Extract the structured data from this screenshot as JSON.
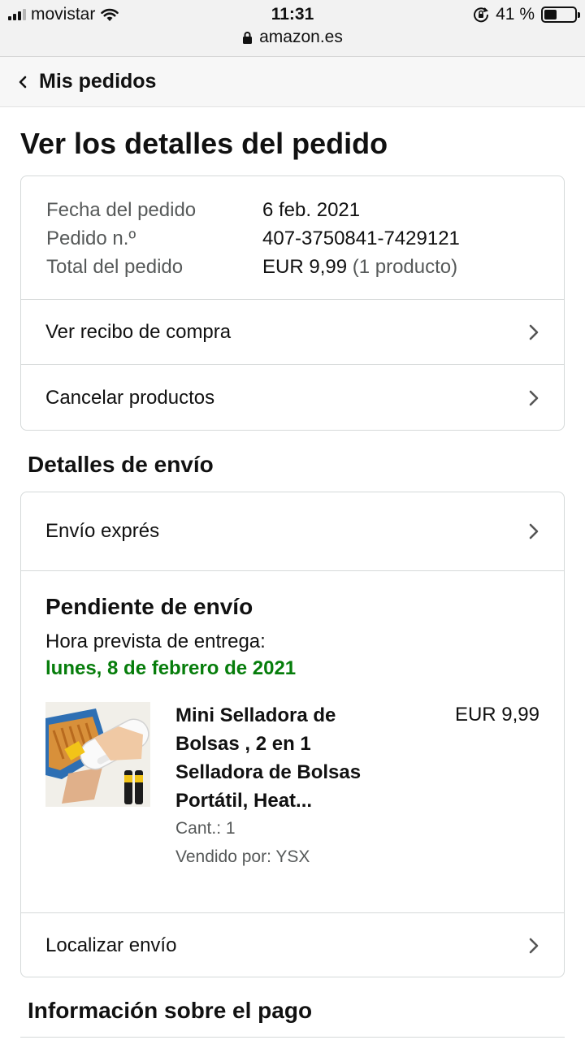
{
  "status_bar": {
    "carrier": "movistar",
    "time": "11:31",
    "battery_percent": "41 %",
    "battery_level": 0.41
  },
  "browser": {
    "url": "amazon.es"
  },
  "nav": {
    "back_label": "Mis pedidos"
  },
  "page": {
    "title": "Ver los detalles del pedido"
  },
  "order": {
    "date_label": "Fecha del pedido",
    "date_value": "6 feb. 2021",
    "number_label": "Pedido n.º",
    "number_value": "407-3750841-7429121",
    "total_label": "Total del pedido",
    "total_value": "EUR 9,99",
    "total_count": "(1 producto)"
  },
  "actions": {
    "receipt": "Ver recibo de compra",
    "cancel": "Cancelar productos"
  },
  "shipping": {
    "section_title": "Detalles de envío",
    "method": "Envío exprés",
    "status": "Pendiente de envío",
    "eta_label": "Hora prevista de entrega:",
    "eta_date": "lunes, 8 de febrero de 2021",
    "track_label": "Localizar envío"
  },
  "product": {
    "name": "Mini Selladora de Bolsas , 2 en 1 Selladora de Bolsas Portátil, Heat...",
    "price": "EUR 9,99",
    "quantity": "Cant.: 1",
    "seller": "Vendido por: YSX"
  },
  "payment": {
    "section_title": "Información sobre el pago"
  },
  "colors": {
    "eta_green": "#067d0b",
    "border": "#d5d9d9",
    "muted_text": "#565959"
  }
}
